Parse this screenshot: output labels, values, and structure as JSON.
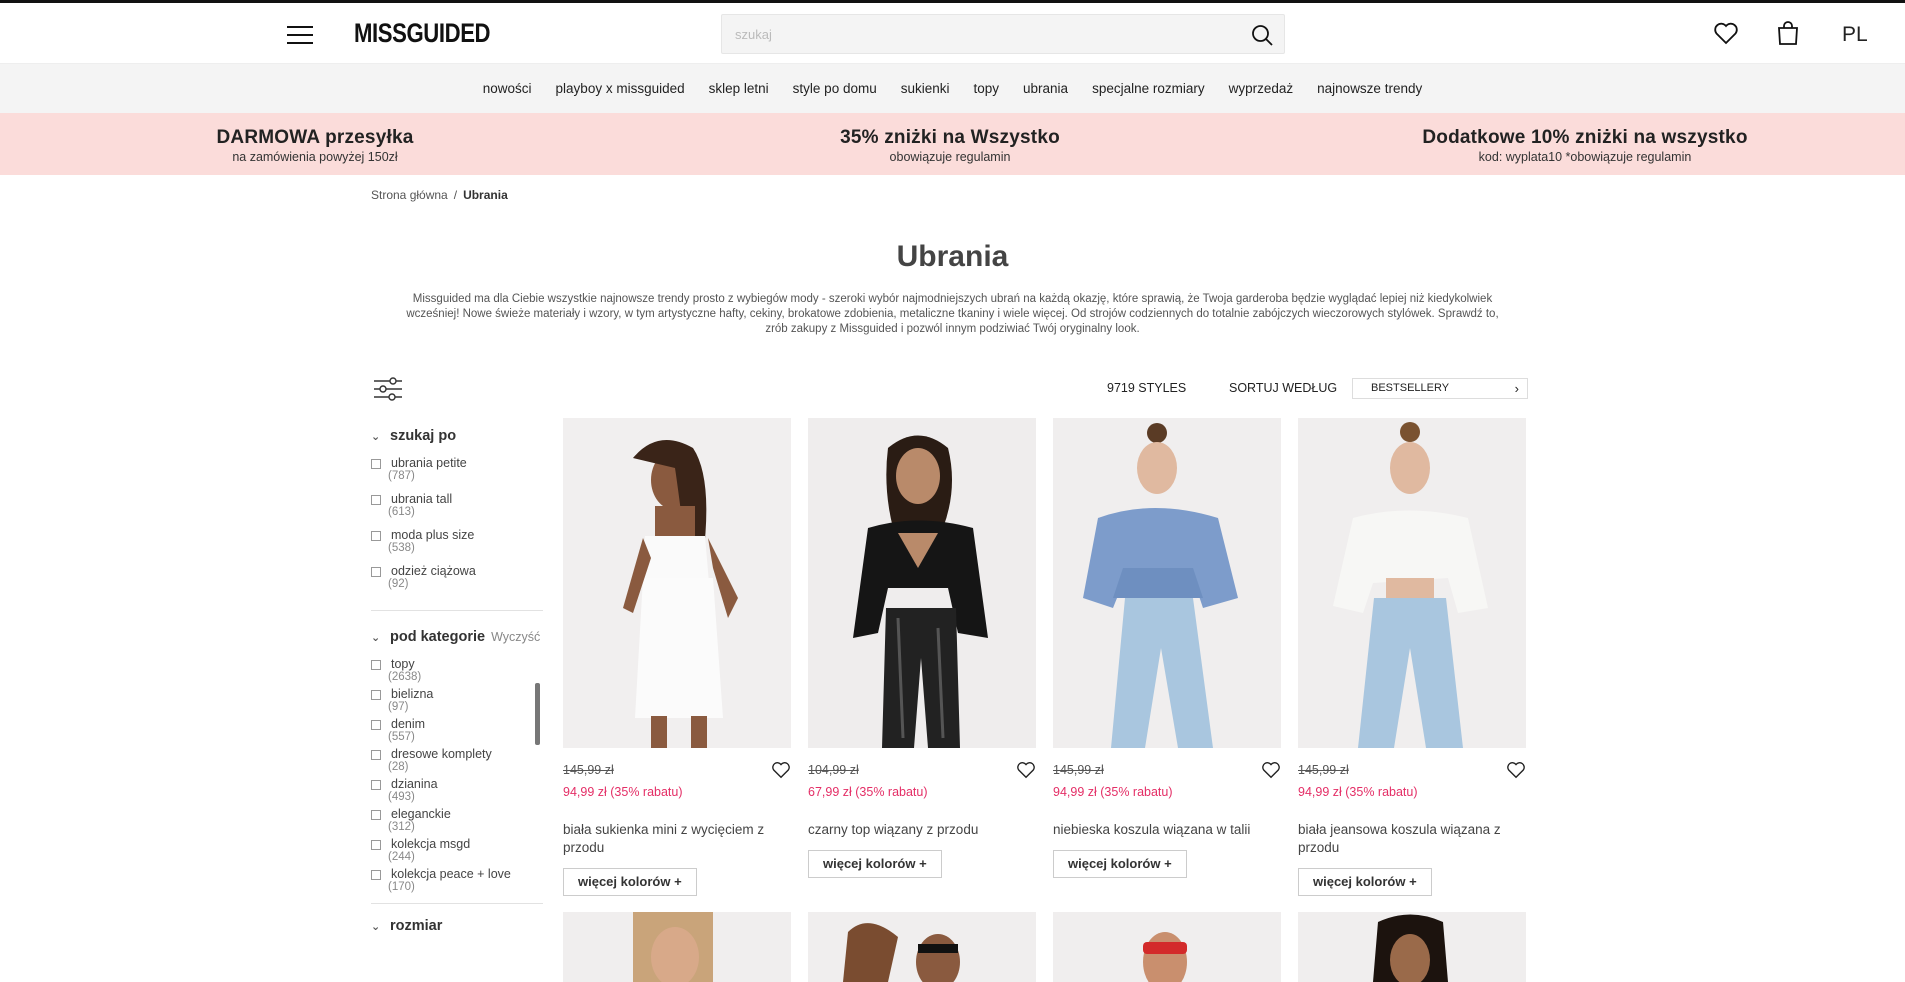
{
  "header": {
    "logo": "MISSGUIDED",
    "search_placeholder": "szukaj",
    "lang": "PL"
  },
  "nav": [
    "nowości",
    "playboy x missguided",
    "sklep letni",
    "style po domu",
    "sukienki",
    "topy",
    "ubrania",
    "specjalne rozmiary",
    "wyprzedaż",
    "najnowsze trendy"
  ],
  "promo": [
    {
      "title": "DARMOWA przesyłka",
      "sub": "na zamówienia powyżej 150zł"
    },
    {
      "title": "35% zniżki na Wszystko",
      "sub": "obowiązuje regulamin"
    },
    {
      "title": "Dodatkowe 10% zniżki na wszystko",
      "sub": "kod: wyplata10 *obowiązuje regulamin"
    }
  ],
  "breadcrumb": {
    "home": "Strona główna",
    "sep": "/",
    "current": "Ubrania"
  },
  "page": {
    "title": "Ubrania",
    "description": "Missguided ma dla Ciebie wszystkie najnowsze trendy prosto z wybiegów mody - szeroki wybór najmodniejszych ubrań na każdą okazję, które sprawią, że Twoja garderoba będzie wyglądać lepiej niż kiedykolwiek wcześniej! Nowe świeże materiały i wzory, w tym artystyczne hafty, cekiny, brokatowe zdobienia, metaliczne tkaniny i wiele więcej. Od strojów codziennych do totalnie zabójczych wieczorowych stylówek. Sprawdź to, zrób zakupy z Missguided i pozwól innym podziwiać Twój oryginalny look."
  },
  "toolbar": {
    "styles_count": "9719 STYLES",
    "sort_label": "SORTUJ WEDŁUG",
    "sort_value": "BESTSELLERY"
  },
  "sidebar": {
    "search_by": {
      "title": "szukaj po",
      "options": [
        {
          "label": "ubrania petite",
          "count": "(787)"
        },
        {
          "label": "ubrania tall",
          "count": "(613)"
        },
        {
          "label": "moda plus size",
          "count": "(538)"
        },
        {
          "label": "odzież ciążowa",
          "count": "(92)"
        }
      ]
    },
    "subcategory": {
      "title": "pod kategorie",
      "clear": "Wyczyść",
      "options": [
        {
          "label": "topy",
          "count": "(2638)"
        },
        {
          "label": "bielizna",
          "count": "(97)"
        },
        {
          "label": "denim",
          "count": "(557)"
        },
        {
          "label": "dresowe komplety",
          "count": "(28)"
        },
        {
          "label": "dzianina",
          "count": "(493)"
        },
        {
          "label": "eleganckie",
          "count": "(312)"
        },
        {
          "label": "kolekcja msgd",
          "count": "(244)"
        },
        {
          "label": "kolekcja peace + love",
          "count": "(170)"
        }
      ]
    },
    "size": {
      "title": "rozmiar"
    }
  },
  "products": [
    {
      "old_price": "145,99 zł",
      "new_price": "94,99 zł (35% rabatu)",
      "name": "biała sukienka mini z wycięciem z przodu",
      "more": "więcej kolorów +"
    },
    {
      "old_price": "104,99 zł",
      "new_price": "67,99 zł (35% rabatu)",
      "name": "czarny top wiązany z przodu",
      "more": "więcej kolorów +"
    },
    {
      "old_price": "145,99 zł",
      "new_price": "94,99 zł (35% rabatu)",
      "name": "niebieska koszula wiązana w talii",
      "more": "więcej kolorów +"
    },
    {
      "old_price": "145,99 zł",
      "new_price": "94,99 zł (35% rabatu)",
      "name": "biała jeansowa koszula wiązana z przodu",
      "more": "więcej kolorów +"
    }
  ],
  "colors": {
    "promo_bg": "#fbdcda",
    "sale_price": "#e42e66",
    "nav_bg": "#f4f4f4"
  }
}
